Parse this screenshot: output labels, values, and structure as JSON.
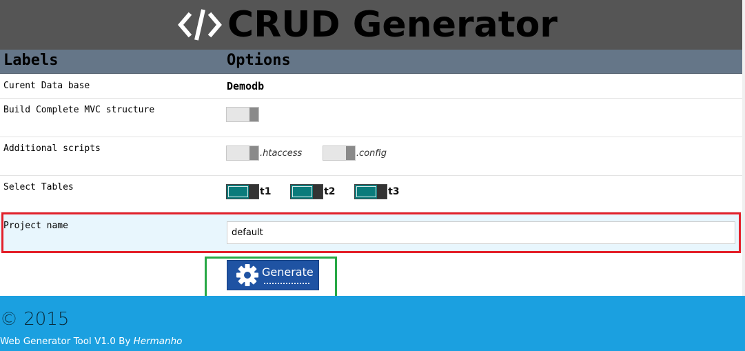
{
  "header": {
    "title": "CRUD Generator",
    "icon": "code-icon"
  },
  "table": {
    "col_labels": "Labels",
    "col_options": "Options"
  },
  "rows": {
    "database": {
      "label": "Curent Data base",
      "value": "Demodb"
    },
    "mvc": {
      "label": "Build Complete MVC structure",
      "enabled": false
    },
    "scripts": {
      "label": "Additional scripts",
      "options": [
        {
          "label": ".htaccess",
          "enabled": false
        },
        {
          "label": ".config",
          "enabled": false
        }
      ]
    },
    "tables": {
      "label": "Select Tables",
      "options": [
        {
          "label": "t1",
          "enabled": true
        },
        {
          "label": "t2",
          "enabled": true
        },
        {
          "label": "t3",
          "enabled": true
        }
      ]
    },
    "project": {
      "label": "Project name",
      "value": "default"
    }
  },
  "generate": {
    "label": "Generate",
    "icon": "gear-icon"
  },
  "footer": {
    "copyright": "© 2015",
    "credit": "Web Generator Tool V1.0 By ",
    "author": "Hermanho"
  },
  "colors": {
    "header_bg": "#555555",
    "table_head_bg": "#657688",
    "toggle_on": "#0a7b7b",
    "button_bg": "#1f53a3",
    "footer_bg": "#1ba0e0",
    "highlight_red": "#e3202a",
    "highlight_green": "#27a845"
  }
}
